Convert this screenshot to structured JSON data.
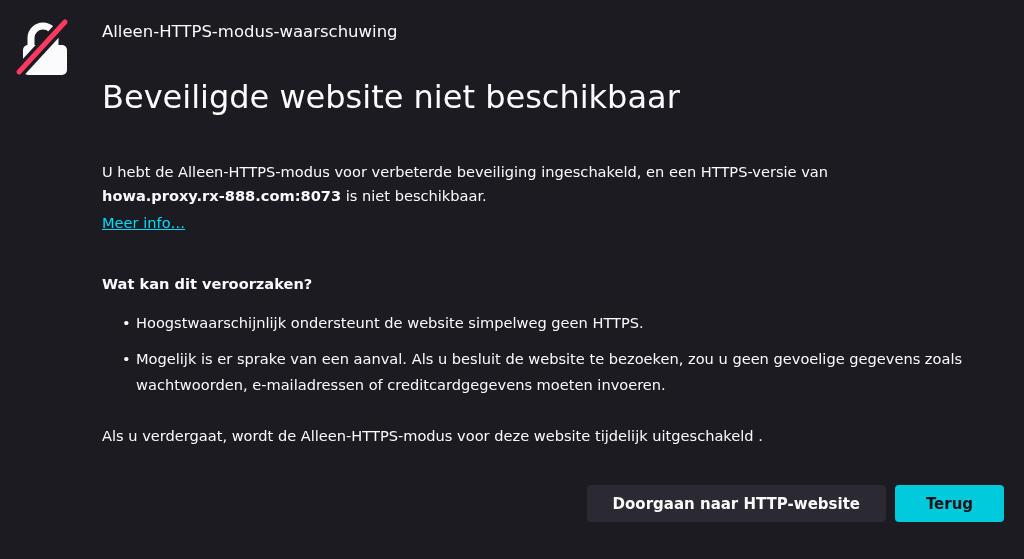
{
  "header": {
    "title": "Alleen-HTTPS-modus-waarschuwing"
  },
  "heading": "Beveiligde website niet beschikbaar",
  "intro": "U hebt de Alleen-HTTPS-modus voor verbeterde beveiliging ingeschakeld, en een HTTPS-versie van **howa.proxy.rx-888.com:8073** is niet beschikbaar.",
  "more_link": "Meer info…",
  "causes": {
    "title": "Wat kan dit veroorzaken?",
    "items": [
      {
        "bullet": "•",
        "text": "Hoogstwaarschijnlijk ondersteunt de website simpelweg geen HTTPS."
      },
      {
        "bullet": "•",
        "text": "Mogelijk is er sprake van een aanval. Als u besluit de website te bezoeken, zou u geen gevoelige gegevens zoals wachtwoorden, e-mailadressen of creditcardgegevens moeten invoeren."
      }
    ]
  },
  "note": "Als u verdergaat, wordt de Alleen-HTTPS-modus voor deze website tijdelijk uitgeschakeld .",
  "buttons": [
    {
      "label": "Doorgaan naar HTTP-website",
      "kind": "secondary"
    },
    {
      "label": "Terug",
      "kind": "primary"
    }
  ]
}
